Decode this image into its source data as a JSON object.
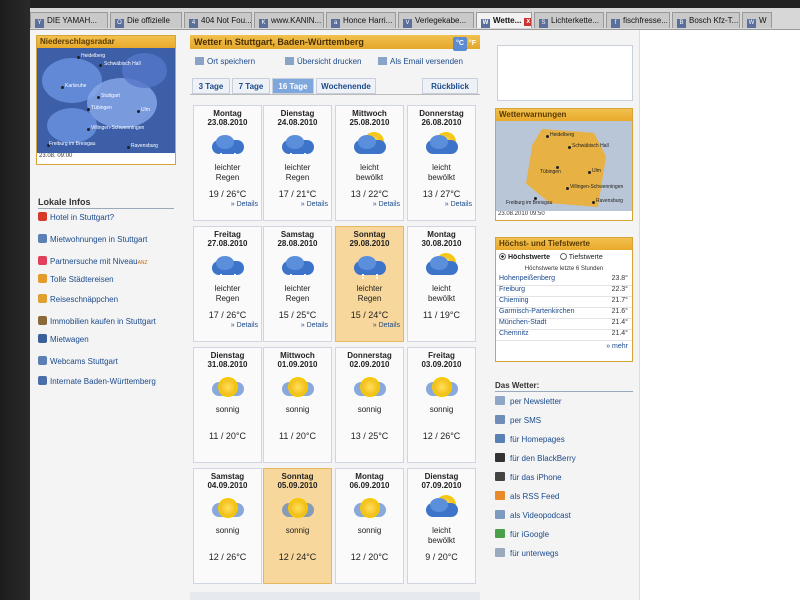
{
  "browser": {
    "tabs": [
      {
        "label": "DIE YAMAH...",
        "fav": "Y"
      },
      {
        "label": "Die offizielle",
        "fav": "O"
      },
      {
        "label": "404 Not Fou...",
        "fav": "4"
      },
      {
        "label": "www.KANIN...",
        "fav": "K"
      },
      {
        "label": "Honce Harri...",
        "fav": "a"
      },
      {
        "label": "Verlegekabe...",
        "fav": "V"
      },
      {
        "label": "Wette...",
        "fav": "W"
      },
      {
        "label": "Lichterkette...",
        "fav": "S"
      },
      {
        "label": "fischfresse...",
        "fav": "f"
      },
      {
        "label": "Bosch Kfz-T...",
        "fav": "B"
      },
      {
        "label": "W",
        "fav": "W"
      }
    ],
    "close_glyph": "x"
  },
  "radar": {
    "title": "Niederschlagsradar",
    "timestamp": "23.08. 09:00",
    "cities": [
      "Heidelberg",
      "Schwäbisch Hall",
      "Karlsruhe",
      "Stuttgart",
      "Tübingen",
      "Ulm",
      "Villingen-Schwenningen",
      "Freiburg im Breisgau",
      "Ravensburg"
    ]
  },
  "local": {
    "title": "Lokale Infos",
    "items": [
      {
        "label": "Hotel in Stuttgart?",
        "color": "#d83a2a"
      },
      {
        "label": "Mietwohnungen in Stuttgart",
        "color": "#5c7fb4"
      },
      {
        "label": "Partnersuche mit Niveau",
        "color": "#e0405a",
        "tag": "ANZ"
      },
      {
        "label": "Tolle Städtereisen",
        "color": "#e39b2b"
      },
      {
        "label": "Reiseschnäppchen",
        "color": "#e0a030"
      },
      {
        "label": "Immobilien kaufen in Stuttgart",
        "color": "#8a6a3a"
      },
      {
        "label": "Mietwagen",
        "color": "#3a5f9a"
      },
      {
        "label": "Webcams Stuttgart",
        "color": "#5c7fb4"
      },
      {
        "label": "Internate Baden-Württemberg",
        "color": "#4a6ea8"
      }
    ]
  },
  "header": {
    "title": "Wetter in Stuttgart, Baden-Württemberg",
    "unit_c": "°C",
    "unit_f": "°F"
  },
  "actions": {
    "save": "Ort speichern",
    "print": "Übersicht drucken",
    "email": "Als Email versenden"
  },
  "range_tabs": [
    "3 Tage",
    "7 Tage",
    "16 Tage",
    "Wochenende",
    "Rückblick"
  ],
  "active_range": "16 Tage",
  "details_label": "» Details",
  "days": [
    {
      "day": "Montag",
      "date": "23.08.2010",
      "desc1": "leichter",
      "desc2": "Regen",
      "temp": "19 / 26°C",
      "icon": "rain",
      "weekend": false,
      "details": true
    },
    {
      "day": "Dienstag",
      "date": "24.08.2010",
      "desc1": "leichter",
      "desc2": "Regen",
      "temp": "17 / 21°C",
      "icon": "rain",
      "weekend": false,
      "details": true
    },
    {
      "day": "Mittwoch",
      "date": "25.08.2010",
      "desc1": "leicht",
      "desc2": "bewölkt",
      "temp": "13 / 22°C",
      "icon": "partly",
      "weekend": false,
      "details": true
    },
    {
      "day": "Donnerstag",
      "date": "26.08.2010",
      "desc1": "leicht",
      "desc2": "bewölkt",
      "temp": "13 / 27°C",
      "icon": "partly",
      "weekend": false,
      "details": true
    },
    {
      "day": "Freitag",
      "date": "27.08.2010",
      "desc1": "leichter",
      "desc2": "Regen",
      "temp": "17 / 26°C",
      "icon": "rain",
      "weekend": false,
      "details": true
    },
    {
      "day": "Samstag",
      "date": "28.08.2010",
      "desc1": "leichter",
      "desc2": "Regen",
      "temp": "15 / 25°C",
      "icon": "rain",
      "weekend": false,
      "details": true
    },
    {
      "day": "Sonntag",
      "date": "29.08.2010",
      "desc1": "leichter",
      "desc2": "Regen",
      "temp": "15 / 24°C",
      "icon": "rain",
      "weekend": true,
      "details": true
    },
    {
      "day": "Montag",
      "date": "30.08.2010",
      "desc1": "leicht",
      "desc2": "bewölkt",
      "temp": "11 / 19°C",
      "icon": "partly",
      "weekend": false,
      "details": false
    },
    {
      "day": "Dienstag",
      "date": "31.08.2010",
      "desc1": "sonnig",
      "desc2": "",
      "temp": "11 / 20°C",
      "icon": "sun",
      "weekend": false,
      "details": false
    },
    {
      "day": "Mittwoch",
      "date": "01.09.2010",
      "desc1": "sonnig",
      "desc2": "",
      "temp": "11 / 20°C",
      "icon": "sun",
      "weekend": false,
      "details": false
    },
    {
      "day": "Donnerstag",
      "date": "02.09.2010",
      "desc1": "sonnig",
      "desc2": "",
      "temp": "13 / 25°C",
      "icon": "sun",
      "weekend": false,
      "details": false
    },
    {
      "day": "Freitag",
      "date": "03.09.2010",
      "desc1": "sonnig",
      "desc2": "",
      "temp": "12 / 26°C",
      "icon": "sun",
      "weekend": false,
      "details": false
    },
    {
      "day": "Samstag",
      "date": "04.09.2010",
      "desc1": "sonnig",
      "desc2": "",
      "temp": "12 / 26°C",
      "icon": "sun",
      "weekend": false,
      "details": false
    },
    {
      "day": "Sonntag",
      "date": "05.09.2010",
      "desc1": "sonnig",
      "desc2": "",
      "temp": "12 / 24°C",
      "icon": "sun",
      "weekend": true,
      "details": false
    },
    {
      "day": "Montag",
      "date": "06.09.2010",
      "desc1": "sonnig",
      "desc2": "",
      "temp": "12 / 20°C",
      "icon": "sun",
      "weekend": false,
      "details": false
    },
    {
      "day": "Dienstag",
      "date": "07.09.2010",
      "desc1": "leicht",
      "desc2": "bewölkt",
      "temp": "9 / 20°C",
      "icon": "partly",
      "weekend": false,
      "details": false
    }
  ],
  "warnings": {
    "title": "Wetterwarnungen",
    "timestamp": "23.08.2010 09:50",
    "cities": [
      "Heidelberg",
      "Schwäbisch Hall",
      "Tübingen",
      "Ulm",
      "Villingen-Schwenningen",
      "Freiburg im Breisgau",
      "Ravensburg"
    ]
  },
  "highlow": {
    "title": "Höchst- und Tiefstwerte",
    "opt_high": "Höchstwerte",
    "opt_low": "Tiefstwerte",
    "subtitle": "Höchstwerte letzte 6 Stunden",
    "rows": [
      {
        "name": "Hohenpeißenberg",
        "value": "23.8°"
      },
      {
        "name": "Freiburg",
        "value": "22.3°"
      },
      {
        "name": "Chieming",
        "value": "21.7°"
      },
      {
        "name": "Garmisch-Partenkirchen",
        "value": "21.6°"
      },
      {
        "name": "München-Stadt",
        "value": "21.4°"
      },
      {
        "name": "Chemnitz",
        "value": "21.4°"
      }
    ],
    "more": "» mehr"
  },
  "channels": {
    "title": "Das Wetter:",
    "items": [
      {
        "label": "per Newsletter",
        "color": "#8fa6c6"
      },
      {
        "label": "per SMS",
        "color": "#6f8db8"
      },
      {
        "label": "für Homepages",
        "color": "#5a7fb4"
      },
      {
        "label": "für den BlackBerry",
        "color": "#333333"
      },
      {
        "label": "für das iPhone",
        "color": "#444444"
      },
      {
        "label": "als RSS Feed",
        "color": "#e8892b"
      },
      {
        "label": "als Videopodcast",
        "color": "#7f9ac0"
      },
      {
        "label": "für iGoogle",
        "color": "#4aa04a"
      },
      {
        "label": "für unterwegs",
        "color": "#9aa9bc"
      }
    ]
  }
}
